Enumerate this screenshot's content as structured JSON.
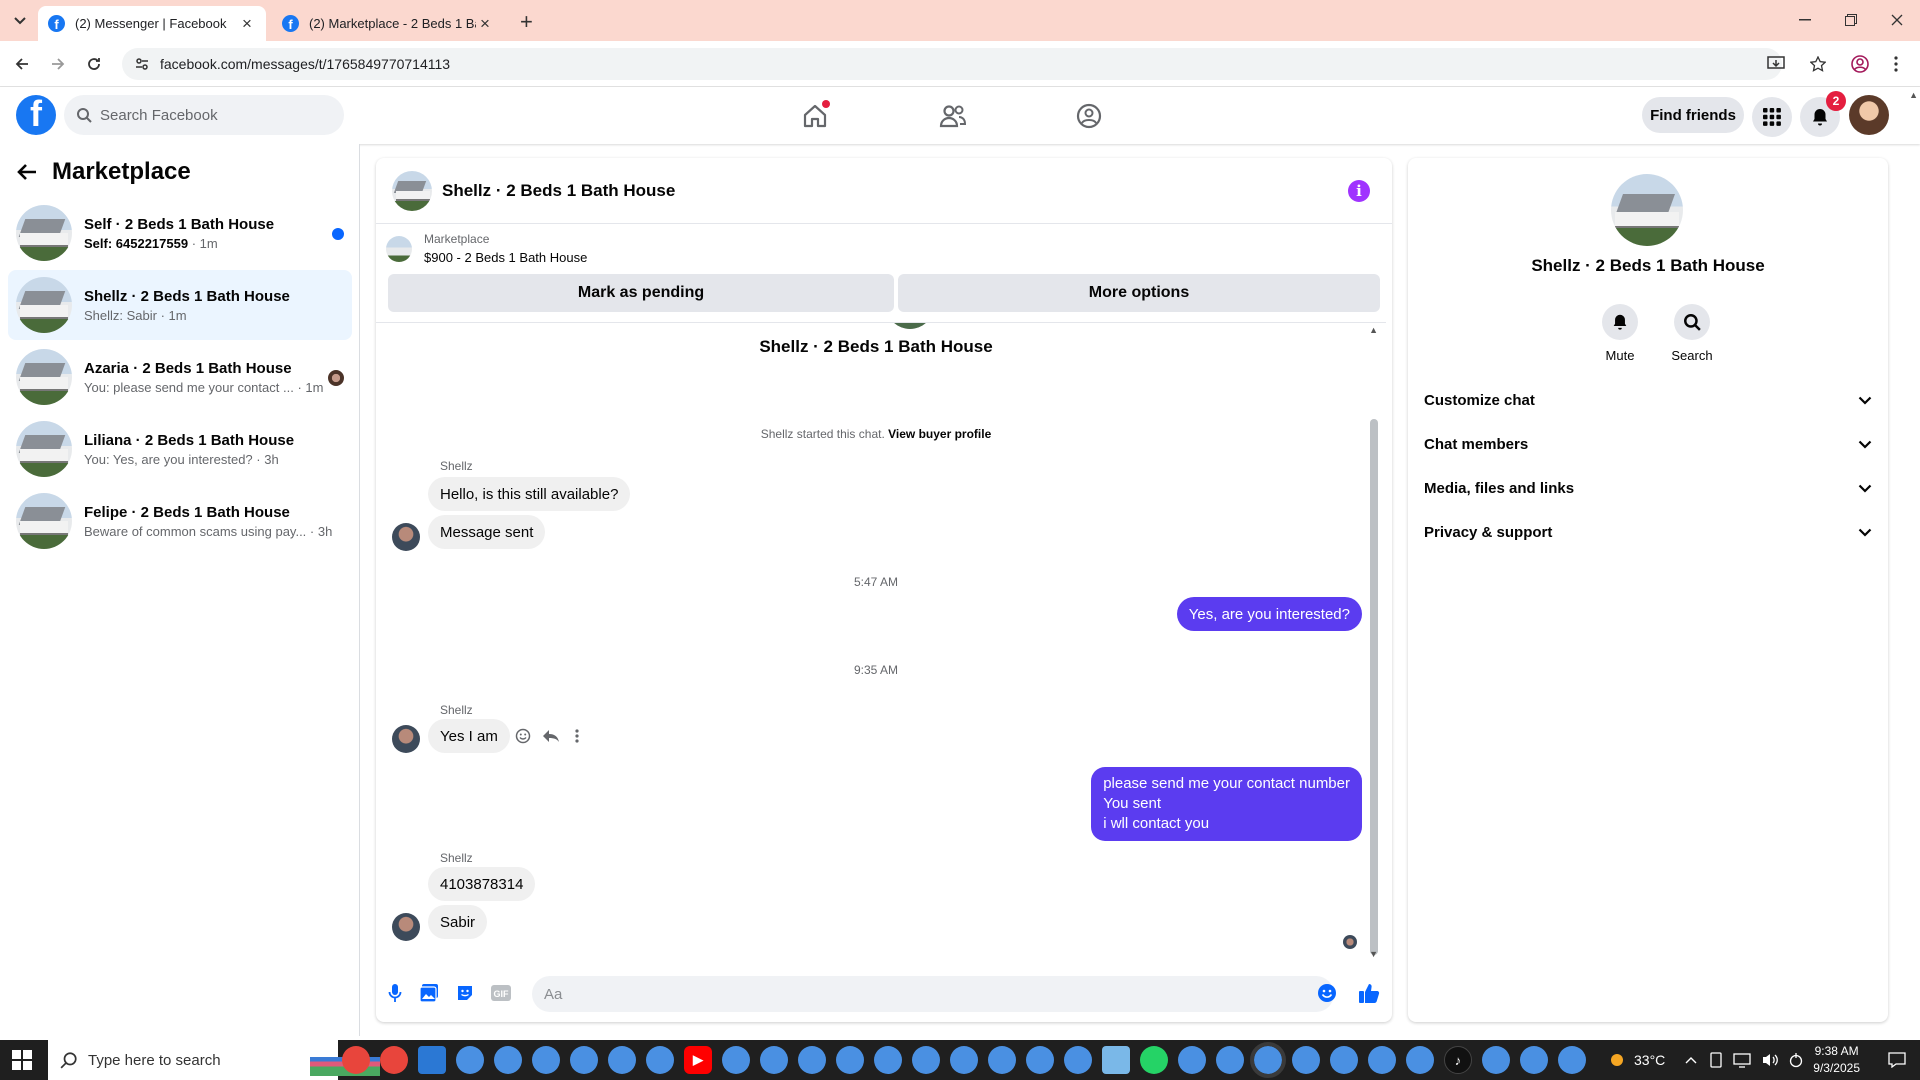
{
  "browser": {
    "tabs": [
      {
        "title": "(2) Messenger | Facebook",
        "active": true
      },
      {
        "title": "(2) Marketplace - 2 Beds 1 Bath",
        "active": false
      }
    ],
    "url": "facebook.com/messages/t/1765849770714113"
  },
  "fb_header": {
    "logo": "f",
    "search_placeholder": "Search Facebook",
    "find_friends": "Find friends",
    "notification_count": "2"
  },
  "left_panel": {
    "title": "Marketplace",
    "conversations": [
      {
        "name": "Self · 2 Beds 1 Bath House",
        "prefix": "Self: 6452217559",
        "text": "",
        "time": "· 1m",
        "unread": true
      },
      {
        "name": "Shellz · 2 Beds 1 Bath House",
        "prefix": "",
        "text": "Shellz: Sabir",
        "time": "· 1m",
        "selected": true
      },
      {
        "name": "Azaria · 2 Beds 1 Bath House",
        "prefix": "",
        "text": "You: please send me your contact ...",
        "time": "· 1m"
      },
      {
        "name": "Liliana · 2 Beds 1 Bath House",
        "prefix": "",
        "text": "You: Yes, are you interested?",
        "time": "· 3h"
      },
      {
        "name": "Felipe · 2 Beds 1 Bath House",
        "prefix": "",
        "text": "Beware of common scams using pay...",
        "time": "· 3h"
      }
    ]
  },
  "chat": {
    "title": "Shellz · 2 Beds 1 Bath House",
    "marketplace_label": "Marketplace",
    "listing": "$900 - 2 Beds 1 Bath House",
    "mark_pending": "Mark as pending",
    "more_options": "More options",
    "center_name": "Shellz · 2 Beds 1 Bath House",
    "started_text": "Shellz started this chat.",
    "buyer_profile": "View buyer profile",
    "sender": "Shellz",
    "messages": {
      "m1": "Hello, is this still available?",
      "m2": "Message sent",
      "ts1": "5:47 AM",
      "m3": "Yes, are you interested?",
      "ts2": "9:35 AM",
      "m4": "Yes I am",
      "m5_line1": "please send me your contact number",
      "m5_line2": "You sent",
      "m5_line3": "i wll contact you",
      "m6": "4103878314",
      "m7": "Sabir"
    },
    "composer_placeholder": "Aa"
  },
  "right_panel": {
    "name": "Shellz · 2 Beds 1 Bath House",
    "mute": "Mute",
    "search": "Search",
    "sections": [
      "Customize chat",
      "Chat members",
      "Media, files and links",
      "Privacy & support"
    ]
  },
  "taskbar": {
    "search_placeholder": "Type here to search",
    "temperature": "33°C",
    "time": "9:38 AM",
    "date": "9/3/2025"
  },
  "colors": {
    "fb_blue": "#1877f2",
    "outgoing_bubble": "#5b3cf0",
    "selected_conv": "#ebf5ff",
    "tabstrip": "#fbd8cf"
  }
}
